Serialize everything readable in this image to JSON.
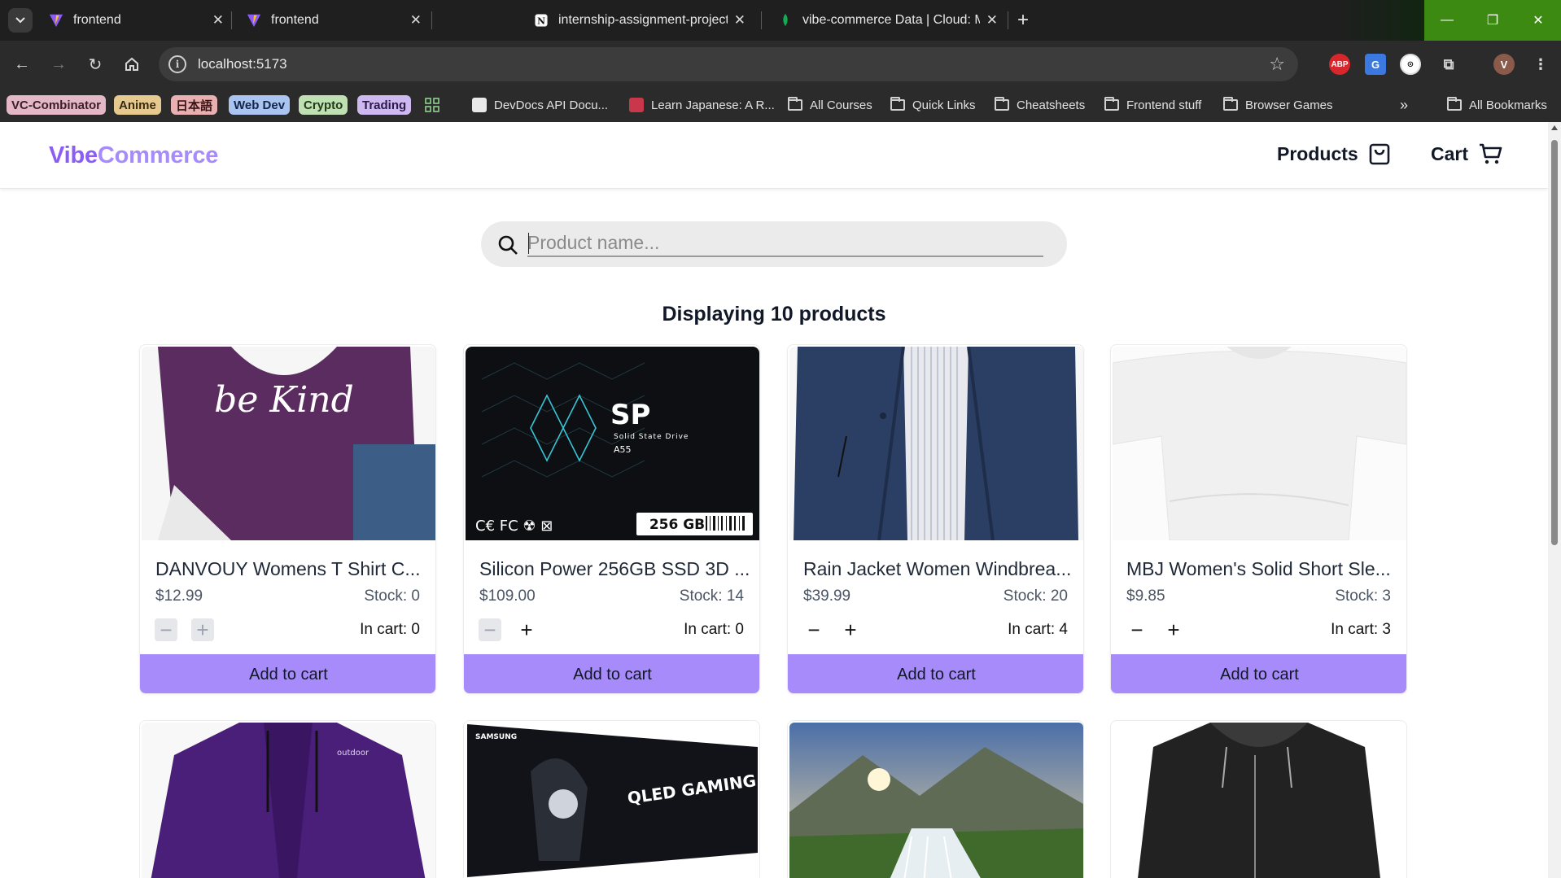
{
  "browser": {
    "tabs": [
      {
        "title": "frontend",
        "icon": "vite-icon"
      },
      {
        "title": "frontend",
        "icon": "vite-icon"
      },
      {
        "title": "internship-assignment-project",
        "icon": "notion-icon"
      },
      {
        "title": "vibe-commerce Data | Cloud: M",
        "icon": "mongodb-leaf-icon"
      }
    ],
    "address": "localhost:5173",
    "bookmark_chips": [
      {
        "label": "VC-Combinator",
        "bg": "#e3b7c5",
        "fg": "#3a1e26"
      },
      {
        "label": "Anime",
        "bg": "#e6c98f",
        "fg": "#3a2a10"
      },
      {
        "label": "日本語",
        "bg": "#e8b0b0",
        "fg": "#3a1414"
      },
      {
        "label": "Web Dev",
        "bg": "#a9c4f0",
        "fg": "#13254a"
      },
      {
        "label": "Crypto",
        "bg": "#bfe0b2",
        "fg": "#1f3a14"
      },
      {
        "label": "Trading",
        "bg": "#cdb8ef",
        "fg": "#2a1a4a"
      }
    ],
    "bookmarks": [
      {
        "label": "DevDocs API Docu...",
        "icon": "devdocs-icon"
      },
      {
        "label": "Learn Japanese: A R...",
        "icon": "tofugu-icon"
      },
      {
        "label": "All Courses",
        "icon": "folder-icon"
      },
      {
        "label": "Quick Links",
        "icon": "folder-icon"
      },
      {
        "label": "Cheatsheets",
        "icon": "folder-icon"
      },
      {
        "label": "Frontend stuff",
        "icon": "folder-icon"
      },
      {
        "label": "Browser Games",
        "icon": "folder-icon"
      }
    ],
    "all_bookmarks": "All Bookmarks",
    "profile_initial": "V"
  },
  "app": {
    "logo_part1": "Vibe",
    "logo_part2": "Commerce",
    "nav": {
      "products": "Products",
      "cart": "Cart"
    },
    "search_placeholder": "Product name...",
    "count_text": "Displaying 10 products",
    "accent": "#a78bfa",
    "brand": "#8b5cf6"
  },
  "products": [
    {
      "name": "DANVOUY Womens T Shirt C...",
      "price": "$12.99",
      "stock": "Stock: 0",
      "in_cart": "In cart: 0",
      "button": "Add to cart",
      "image_text": "be Kind"
    },
    {
      "name": "Silicon Power 256GB SSD 3D ...",
      "price": "$109.00",
      "stock": "Stock: 14",
      "in_cart": "In cart: 0",
      "button": "Add to cart",
      "image_text": "SP",
      "image_text2": "Solid State Drive",
      "image_text3": "A55",
      "image_text4": "256 GB"
    },
    {
      "name": "Rain Jacket Women Windbrea...",
      "price": "$39.99",
      "stock": "Stock: 20",
      "in_cart": "In cart: 4",
      "button": "Add to cart"
    },
    {
      "name": "MBJ Women's Solid Short Sle...",
      "price": "$9.85",
      "stock": "Stock: 3",
      "in_cart": "In cart: 3",
      "button": "Add to cart"
    }
  ],
  "products_row2": [
    {
      "image": "purple-jacket"
    },
    {
      "image": "samsung-monitor",
      "image_text": "SAMSUNG",
      "image_text2": "QLED GAMING MONITOR"
    },
    {
      "image": "waterfall-landscape"
    },
    {
      "image": "black-leather-jacket"
    }
  ]
}
